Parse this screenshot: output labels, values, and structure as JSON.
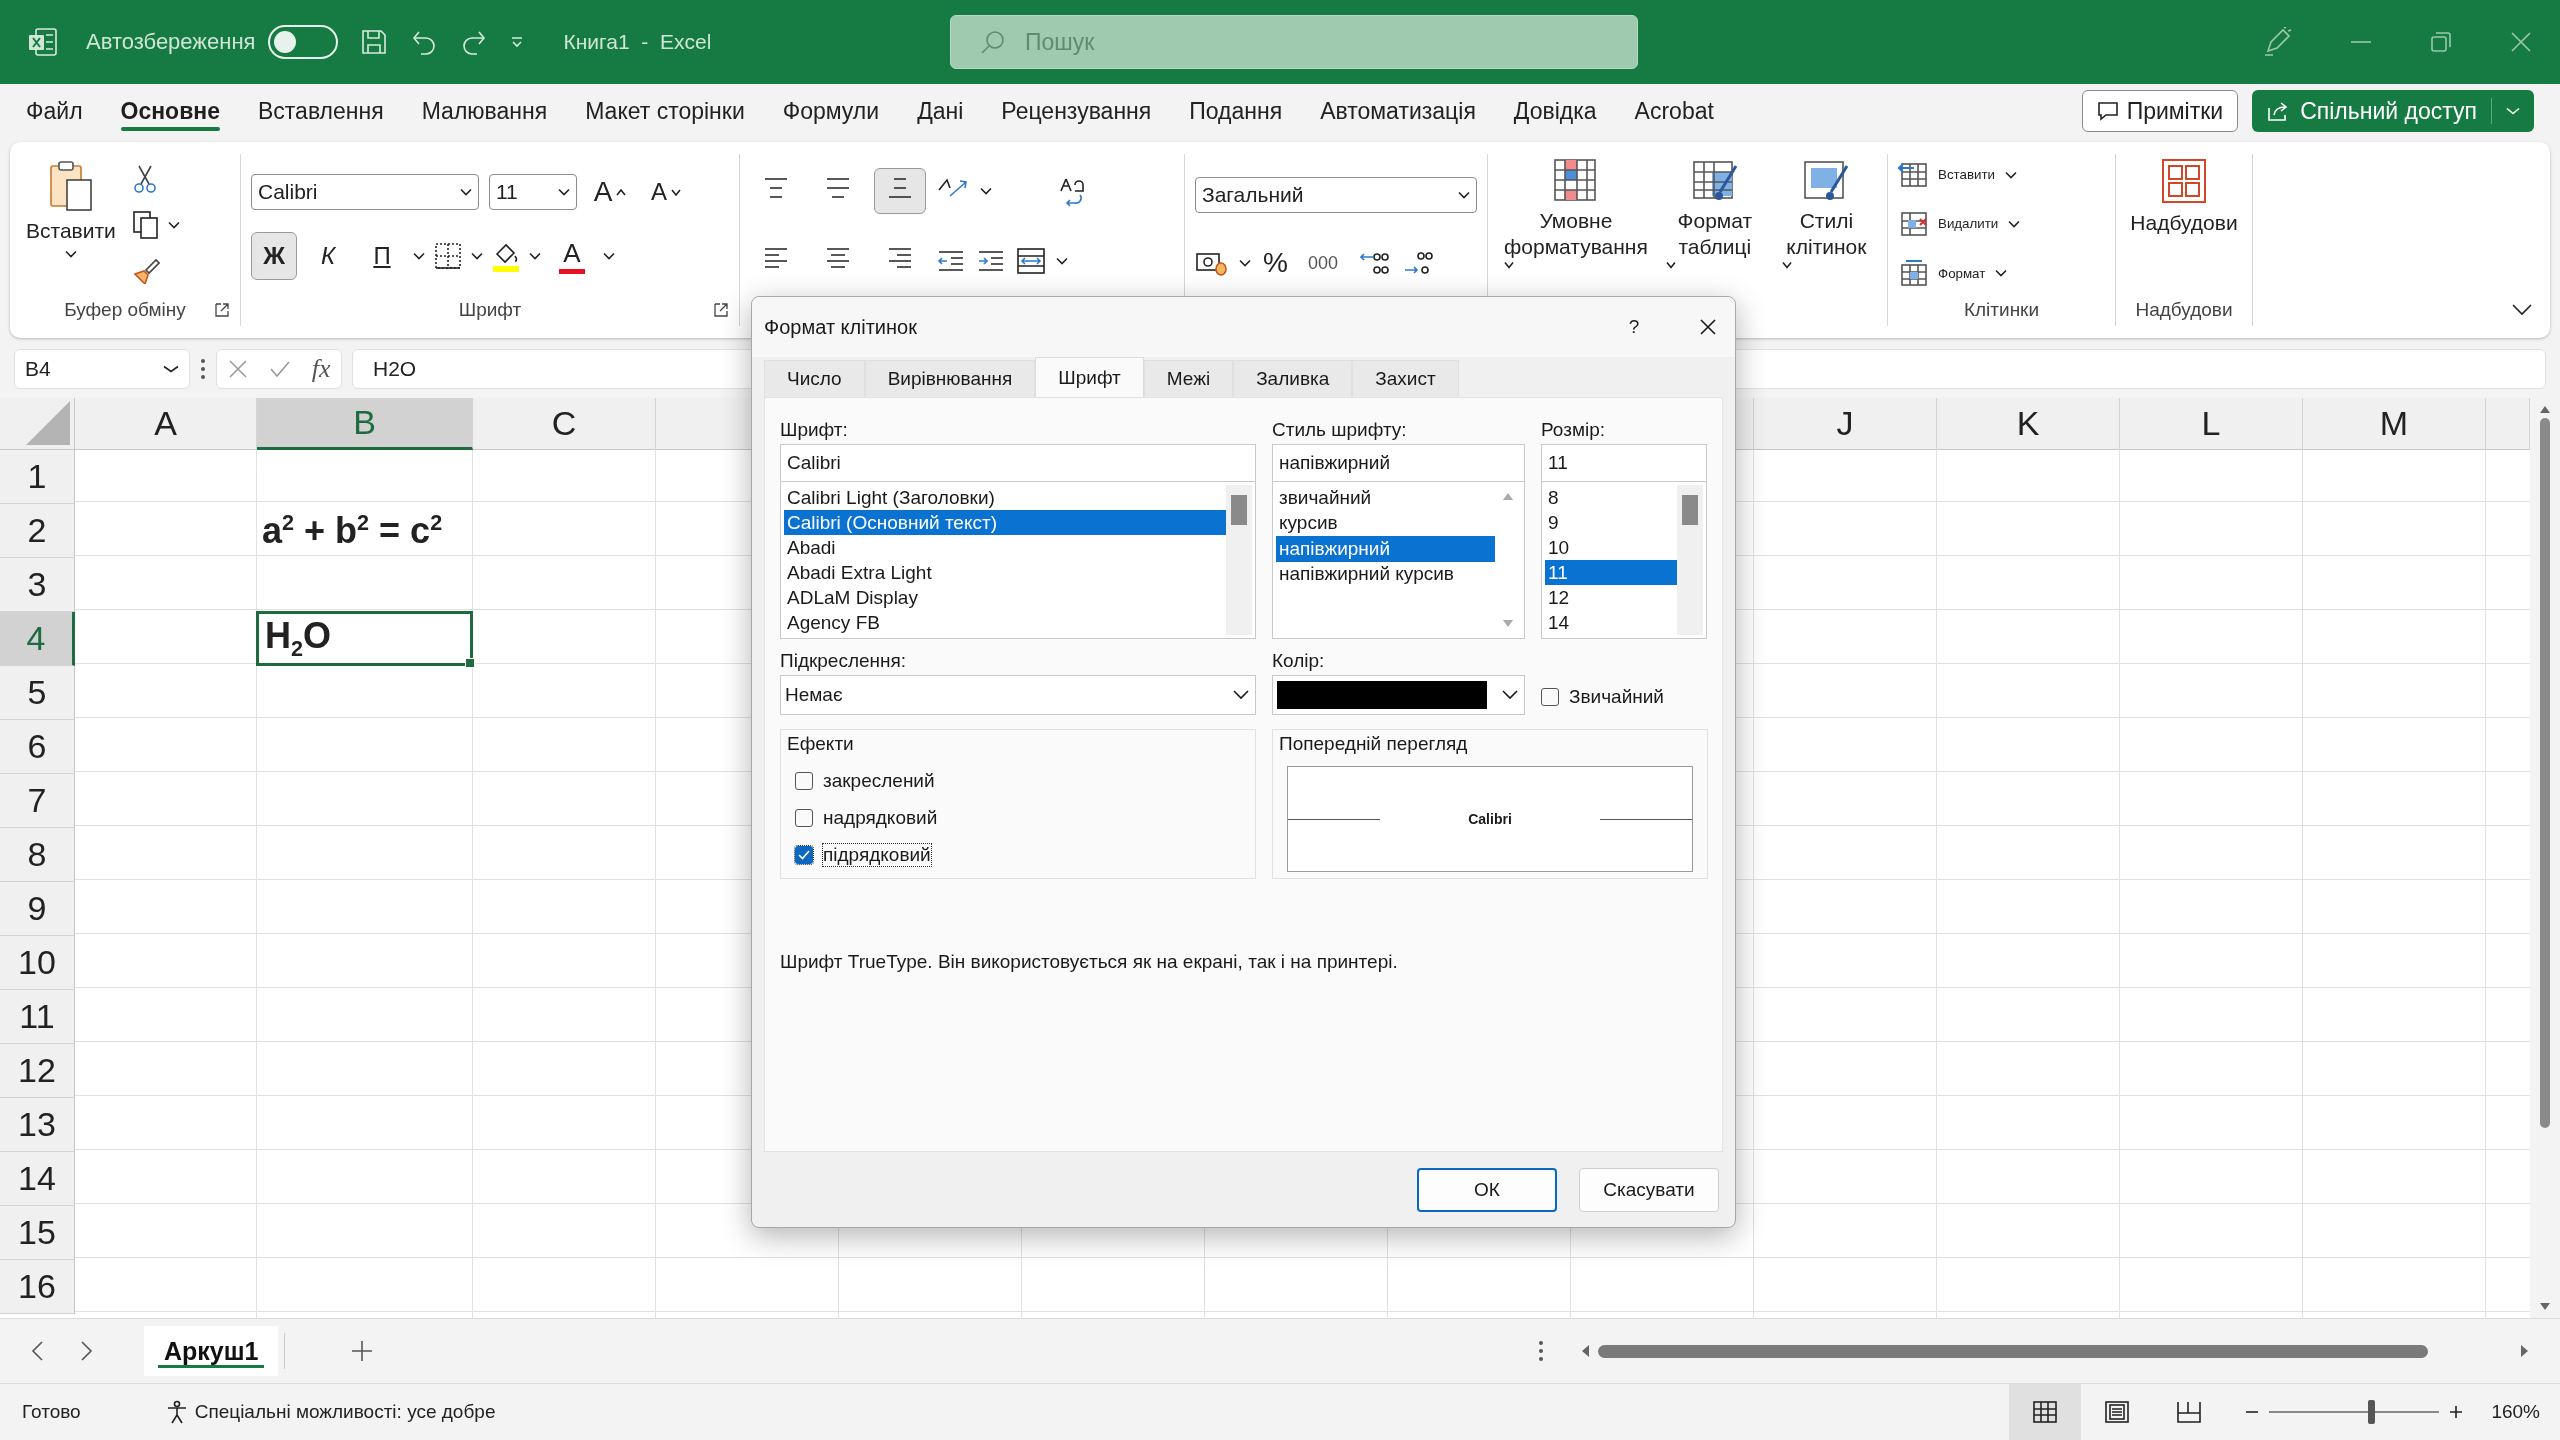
{
  "titlebar": {
    "autosave_label": "Автозбереження",
    "autosave_on": false,
    "doc_title": "Книга1  -  Excel",
    "search_placeholder": "Пошук"
  },
  "menu": {
    "tabs": [
      {
        "label": "Файл",
        "selected": false
      },
      {
        "label": "Основне",
        "selected": true
      },
      {
        "label": "Вставлення",
        "selected": false
      },
      {
        "label": "Малювання",
        "selected": false
      },
      {
        "label": "Макет сторінки",
        "selected": false
      },
      {
        "label": "Формули",
        "selected": false
      },
      {
        "label": "Дані",
        "selected": false
      },
      {
        "label": "Рецензування",
        "selected": false
      },
      {
        "label": "Подання",
        "selected": false
      },
      {
        "label": "Автоматизація",
        "selected": false
      },
      {
        "label": "Довідка",
        "selected": false
      },
      {
        "label": "Acrobat",
        "selected": false
      }
    ],
    "comments_button": "Примітки",
    "share_button": "Спільний доступ"
  },
  "ribbon": {
    "clipboard": {
      "paste": "Вставити",
      "label": "Буфер обміну"
    },
    "font": {
      "font_name": "Calibri",
      "font_size": "11",
      "grow": "A",
      "shrink": "A",
      "font_color": "A",
      "label": "Шрифт",
      "styles": [
        {
          "kind": "bold",
          "label": "Ж",
          "selected": true
        },
        {
          "kind": "italic",
          "label": "К",
          "selected": false
        },
        {
          "kind": "underline",
          "label": "П",
          "selected": false
        }
      ]
    },
    "alignment": {
      "vertical": [
        {
          "kind": "top",
          "selected": false
        },
        {
          "kind": "middle",
          "selected": false
        },
        {
          "kind": "bottom",
          "selected": true
        }
      ],
      "horizontal": [
        {
          "kind": "left",
          "selected": false
        },
        {
          "kind": "center",
          "selected": false
        },
        {
          "kind": "right",
          "selected": false
        }
      ]
    },
    "number": {
      "format": "Загальний",
      "percent": "%",
      "thousands": "000"
    },
    "styles": [
      {
        "kind": "conditional",
        "label": "Умовне форматування"
      },
      {
        "kind": "table",
        "label": "Формат таблиці"
      },
      {
        "kind": "cell",
        "label": "Стилі клітинок"
      }
    ],
    "cells": {
      "label": "Клітинки",
      "items": [
        {
          "kind": "insert",
          "label": "Вставити"
        },
        {
          "kind": "delete",
          "label": "Видалити"
        },
        {
          "kind": "format",
          "label": "Формат"
        }
      ]
    },
    "addins": {
      "button": "Надбудови",
      "label": "Надбудови"
    }
  },
  "formula_bar": {
    "name_box": "B4",
    "fx": "fx",
    "value": "H2O"
  },
  "sheet": {
    "columns": [
      {
        "label": "A",
        "selected": false
      },
      {
        "label": "B",
        "selected": true
      },
      {
        "label": "C",
        "selected": false
      },
      {
        "label": "J",
        "selected": false
      },
      {
        "label": "K",
        "selected": false
      },
      {
        "label": "L",
        "selected": false
      },
      {
        "label": "M",
        "selected": false
      }
    ],
    "rows": [
      {
        "label": "1",
        "selected": false
      },
      {
        "label": "2",
        "selected": false,
        "cell_b": "a$^{2}$ + b$^{2}$ = c$^{2}$"
      },
      {
        "label": "3",
        "selected": false
      },
      {
        "label": "4",
        "selected": true,
        "cell_b": "H$_{2}$O"
      },
      {
        "label": "5",
        "selected": false
      },
      {
        "label": "6",
        "selected": false
      },
      {
        "label": "7",
        "selected": false
      },
      {
        "label": "8",
        "selected": false
      },
      {
        "label": "9",
        "selected": false
      },
      {
        "label": "10",
        "selected": false
      },
      {
        "label": "11",
        "selected": false
      },
      {
        "label": "12",
        "selected": false
      },
      {
        "label": "13",
        "selected": false
      },
      {
        "label": "14",
        "selected": false
      },
      {
        "label": "15",
        "selected": false
      },
      {
        "label": "16",
        "selected": false
      }
    ]
  },
  "sheet_tabs": [
    {
      "label": "Аркуш1",
      "selected": true
    }
  ],
  "status_bar": {
    "ready": "Готово",
    "accessibility": "Спеціальні можливості: усе добре",
    "views": [
      {
        "kind": "normal",
        "selected": true
      },
      {
        "kind": "page_layout",
        "selected": false
      },
      {
        "kind": "page_break",
        "selected": false
      }
    ],
    "zoom_slider": {
      "level": 0.6
    },
    "zoom": "160%"
  },
  "dialog": {
    "title": "Формат клітинок",
    "help": "?",
    "tabs": [
      {
        "label": "Число",
        "selected": false
      },
      {
        "label": "Вирівнювання",
        "selected": false
      },
      {
        "label": "Шрифт",
        "selected": true
      },
      {
        "label": "Межі",
        "selected": false
      },
      {
        "label": "Заливка",
        "selected": false
      },
      {
        "label": "Захист",
        "selected": false
      }
    ],
    "font_label": "Шрифт:",
    "font_value": "Calibri",
    "fonts": [
      {
        "label": "Calibri Light (Заголовки)",
        "selected": false
      },
      {
        "label": "Calibri (Основний текст)",
        "selected": true
      },
      {
        "label": "Abadi",
        "selected": false
      },
      {
        "label": "Abadi Extra Light",
        "selected": false
      },
      {
        "label": "ADLaM Display",
        "selected": false
      },
      {
        "label": "Agency FB",
        "selected": false
      }
    ],
    "style_label": "Стиль шрифту:",
    "style_value": "напівжирний",
    "styles": [
      {
        "label": "звичайний",
        "selected": false
      },
      {
        "label": "курсив",
        "selected": false
      },
      {
        "label": "напівжирний",
        "selected": true
      },
      {
        "label": "напівжирний курсив",
        "selected": false
      }
    ],
    "size_label": "Розмір:",
    "size_value": "11",
    "sizes": [
      {
        "label": "8",
        "selected": false
      },
      {
        "label": "9",
        "selected": false
      },
      {
        "label": "10",
        "selected": false
      },
      {
        "label": "11",
        "selected": true
      },
      {
        "label": "12",
        "selected": false
      },
      {
        "label": "14",
        "selected": false
      }
    ],
    "underline_label": "Підкреслення:",
    "underline_value": "Немає",
    "color_label": "Колір:",
    "color": "#000000",
    "normal_font": {
      "label": "Звичайний",
      "checked": false
    },
    "effects_label": "Ефекти",
    "effects": [
      {
        "label": "закреслений",
        "checked": false
      },
      {
        "label": "надрядковий",
        "checked": false
      },
      {
        "label": "підрядковий",
        "checked": true
      }
    ],
    "preview_label": "Попередній перегляд",
    "preview_text": "Calibri",
    "description": "Шрифт TrueType. Він використовується як на екрані, так і на принтері.",
    "buttons": [
      {
        "label": "ОК",
        "kind": "primary"
      },
      {
        "label": "Скасувати",
        "kind": "secondary"
      }
    ]
  }
}
